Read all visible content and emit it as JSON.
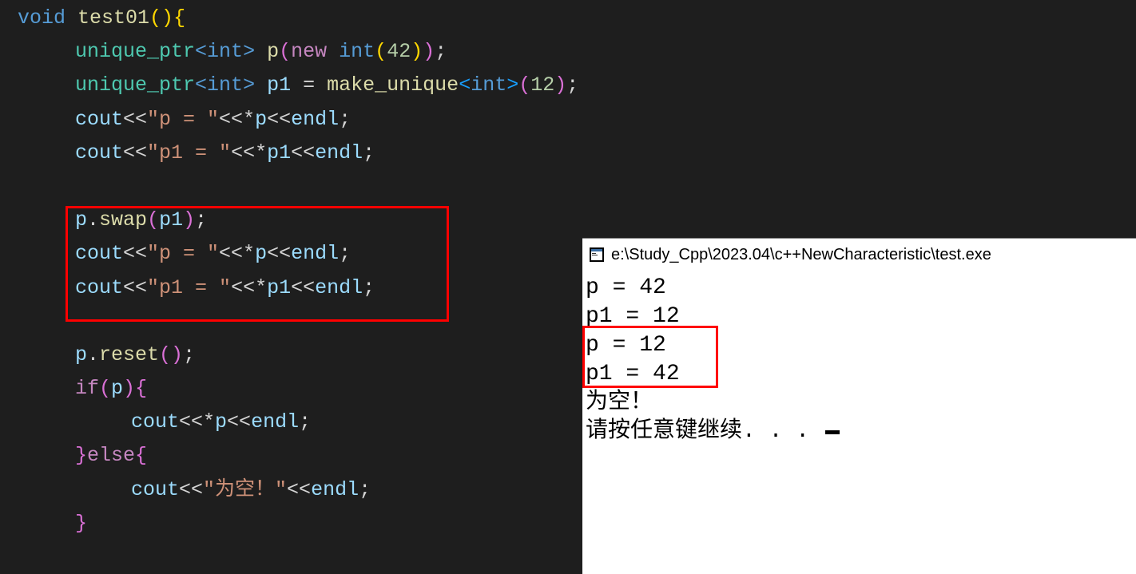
{
  "code": {
    "l1_void": "void",
    "l1_fn": "test01",
    "l2_type": "unique_ptr",
    "l2_int": "int",
    "l2_var": "p",
    "l2_new": "new",
    "l2_int2": "int",
    "l2_num": "42",
    "l3_type": "unique_ptr",
    "l3_int": "int",
    "l3_var": "p1",
    "l3_fn": "make_unique",
    "l3_int2": "int",
    "l3_num": "12",
    "l4_cout": "cout",
    "l4_str": "\"p = \"",
    "l4_var": "p",
    "l4_endl": "endl",
    "l5_cout": "cout",
    "l5_str": "\"p1 = \"",
    "l5_var": "p1",
    "l5_endl": "endl",
    "l7_var": "p",
    "l7_fn": "swap",
    "l7_arg": "p1",
    "l8_cout": "cout",
    "l8_str": "\"p = \"",
    "l8_var": "p",
    "l8_endl": "endl",
    "l9_cout": "cout",
    "l9_str": "\"p1 = \"",
    "l9_var": "p1",
    "l9_endl": "endl",
    "l11_var": "p",
    "l11_fn": "reset",
    "l12_if": "if",
    "l12_var": "p",
    "l13_cout": "cout",
    "l13_var": "p",
    "l13_endl": "endl",
    "l14_else": "else",
    "l15_cout": "cout",
    "l15_str": "\"为空！\"",
    "l15_endl": "endl"
  },
  "terminal": {
    "title": "e:\\Study_Cpp\\2023.04\\c++NewCharacteristic\\test.exe",
    "line1": "p = 42",
    "line2": "p1 = 12",
    "line3": "p = 12",
    "line4": "p1 = 42",
    "line5": "为空！",
    "line6": "请按任意键继续. . . "
  }
}
